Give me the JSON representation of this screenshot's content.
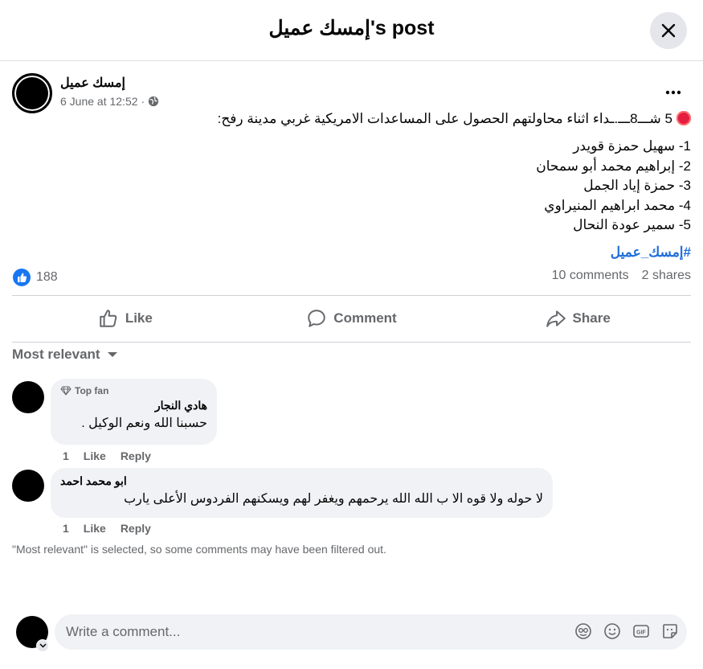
{
  "header": {
    "title": "إمسك عميل's post"
  },
  "post": {
    "author": "إمسك عميل",
    "timestamp": "6 June at 12:52",
    "separator": "·",
    "headline": "5 شـــ8ـــ.ـداء اثناء محاولتهم الحصول على المساعدات الامريكية غربي مدينة رفح:",
    "names": [
      "1- سهيل حمزة قويدر",
      "2- إبراهيم محمد أبو سمحان",
      "3- حمزة إياد الجمل",
      "4- محمد ابراهيم المنيراوي",
      "5- سمير عودة النحال"
    ],
    "hashtag": "#إمسك_عميل",
    "reaction_count": "188",
    "comments_count": "10 comments",
    "shares_count": "2 shares"
  },
  "actions": {
    "like": "Like",
    "comment": "Comment",
    "share": "Share"
  },
  "sort": {
    "label": "Most relevant"
  },
  "comments": [
    {
      "badge": "Top fan",
      "name": "هادي النجار",
      "text": "حسبنا الله ونعم الوكيل .",
      "likes": "1",
      "like_label": "Like",
      "reply_label": "Reply"
    },
    {
      "name": "ابو محمد احمد",
      "text": "لا حوله ولا قوه الا ب الله الله يرحمهم ويغفر لهم ويسكنهم الفردوس الأعلى يارب",
      "likes": "1",
      "like_label": "Like",
      "reply_label": "Reply"
    }
  ],
  "filter_note": "\"Most relevant\" is selected, so some comments may have been filtered out.",
  "composer": {
    "placeholder": "Write a comment..."
  },
  "colors": {
    "link": "#216fdb",
    "like_blue": "#1877f2",
    "live_red": "#e41e3f",
    "muted": "#65676b"
  },
  "icons": [
    "close-icon",
    "globe-icon",
    "more-icon",
    "like-reaction-icon",
    "thumbs-up-icon",
    "comment-icon",
    "share-icon",
    "caret-down-icon",
    "diamond-icon",
    "chevron-down-icon",
    "avatar-frame-icon",
    "emoji-icon",
    "gif-icon",
    "sticker-icon"
  ]
}
